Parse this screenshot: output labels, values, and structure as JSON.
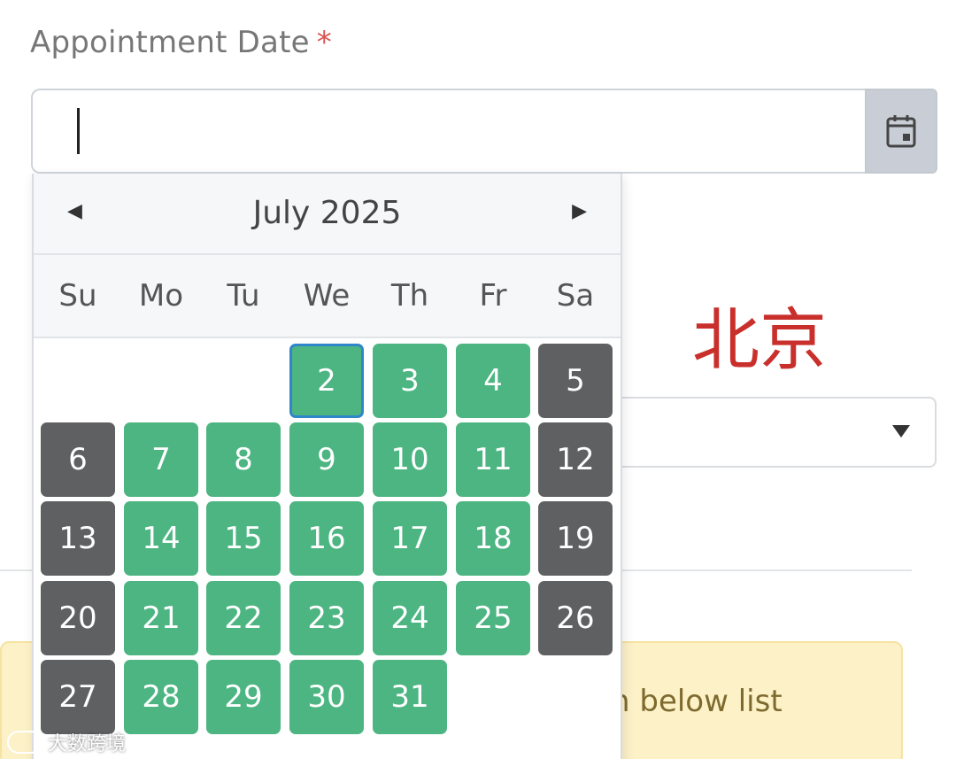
{
  "form": {
    "label": "Appointment Date",
    "required_mark": "*"
  },
  "city": "北京",
  "alert": {
    "text": "n below list"
  },
  "datepicker": {
    "month_title": "July 2025",
    "prev_icon": "◀",
    "next_icon": "▶",
    "weekdays": [
      "Su",
      "Mo",
      "Tu",
      "We",
      "Th",
      "Fr",
      "Sa"
    ],
    "days": [
      "2",
      "3",
      "4",
      "5",
      "6",
      "7",
      "8",
      "9",
      "10",
      "11",
      "12",
      "13",
      "14",
      "15",
      "16",
      "17",
      "18",
      "19",
      "20",
      "21",
      "22",
      "23",
      "24",
      "25",
      "26",
      "27",
      "28",
      "29",
      "30",
      "31"
    ],
    "selected_day": "2",
    "colors": {
      "available": "#4cb582",
      "unavailable": "#5f6061",
      "selected_border": "#2f86c9"
    }
  },
  "watermark": "大数跨境",
  "icons": {
    "calendar": "calendar-icon",
    "dropdown": "chevron-down-icon"
  }
}
